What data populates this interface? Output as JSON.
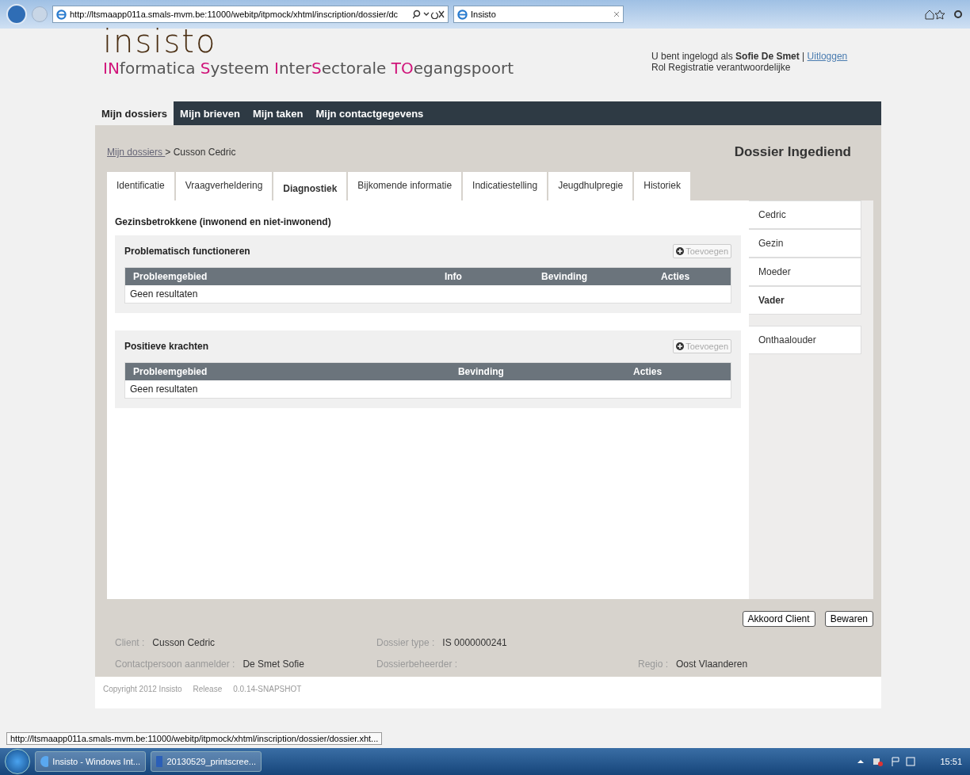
{
  "browser": {
    "address": "http://ltsmaapp011a.smals-mvm.be:11000/webitp/itpmock/xhtml/inscription/dossier/dc",
    "tab_title": "Insisto"
  },
  "header": {
    "logo": "insisto",
    "tagline": [
      {
        "text": "IN",
        "highlight": true
      },
      {
        "text": "formatica ",
        "highlight": false
      },
      {
        "text": "S",
        "highlight": true
      },
      {
        "text": "ysteem ",
        "highlight": false
      },
      {
        "text": "I",
        "highlight": true
      },
      {
        "text": "nter",
        "highlight": false
      },
      {
        "text": "S",
        "highlight": true
      },
      {
        "text": "ectorale  ",
        "highlight": false
      },
      {
        "text": "TO",
        "highlight": true
      },
      {
        "text": "egangspoort",
        "highlight": false
      }
    ],
    "user_line": "U bent ingelogd als **Sofie De Smet** |",
    "logout": "Uitloggen",
    "role": "Rol Registratie verantwoordelijke"
  },
  "nav": [
    {
      "label": "Mijn dossiers",
      "selected": true
    },
    {
      "label": "Mijn brieven",
      "selected": false
    },
    {
      "label": "Mijn taken",
      "selected": false
    },
    {
      "label": "Mijn contactgegevens",
      "selected": false
    }
  ],
  "breadcrumb": {
    "link": "Mijn dossiers ",
    "current": "> Cusson Cedric"
  },
  "dossier_status": "Dossier Ingediend",
  "tabs": [
    {
      "label": "Identificatie",
      "selected": false
    },
    {
      "label": "Vraagverheldering",
      "selected": false
    },
    {
      "label": "Diagnostiek",
      "selected": true
    },
    {
      "label": "Bijkomende informatie",
      "selected": false
    },
    {
      "label": "Indicatiestelling",
      "selected": false
    },
    {
      "label": "Jeugdhulpregie",
      "selected": false
    },
    {
      "label": "Historiek",
      "selected": false
    }
  ],
  "section_title": "Gezinsbetrokkene (inwonend en niet-inwonend)",
  "panels": [
    {
      "title": "Problematisch functioneren",
      "add_button": {
        "label": "Toevoegen",
        "disabled": true
      },
      "columns": [
        "Probleemgebied",
        "Info",
        "Bevinding",
        "Acties"
      ],
      "empty": "Geen resultaten"
    },
    {
      "title": "Positieve krachten",
      "add_button": {
        "label": "Toevoegen",
        "disabled": true
      },
      "columns": [
        "Probleemgebied",
        "Bevinding",
        "Acties"
      ],
      "empty": "Geen resultaten"
    }
  ],
  "side_groups": [
    {
      "items": [
        {
          "label": "Cedric",
          "selected": false
        },
        {
          "label": "Gezin",
          "selected": false
        },
        {
          "label": "Moeder",
          "selected": false
        },
        {
          "label": "Vader",
          "selected": true
        }
      ]
    },
    {
      "items": [
        {
          "label": "Onthaalouder",
          "selected": false
        }
      ]
    }
  ],
  "buttons": [
    "Akkoord Client",
    "Bewaren"
  ],
  "info_rows": [
    [
      {
        "label": "Client :",
        "value": "Cusson Cedric"
      },
      {
        "label": "Dossier type :",
        "value": "IS 0000000241"
      }
    ],
    [
      {
        "label": "Contactpersoon aanmelder :",
        "value": "De Smet Sofie"
      },
      {
        "label": "Dossierbeheerder :"
      },
      {
        "label": "Regio :",
        "value": "Oost Vlaanderen"
      }
    ]
  ],
  "copyright": [
    "Copyright 2012 Insisto",
    "Release",
    "0.0.14-SNAPSHOT"
  ],
  "status_url": "http://ltsmaapp011a.smals-mvm.be:11000/webitp/itpmock/xhtml/inscription/dossier/dossier.xht...",
  "taskbar": {
    "items": [
      "Insisto - Windows Int...",
      "20130529_printscree..."
    ],
    "clock": "15:51"
  }
}
